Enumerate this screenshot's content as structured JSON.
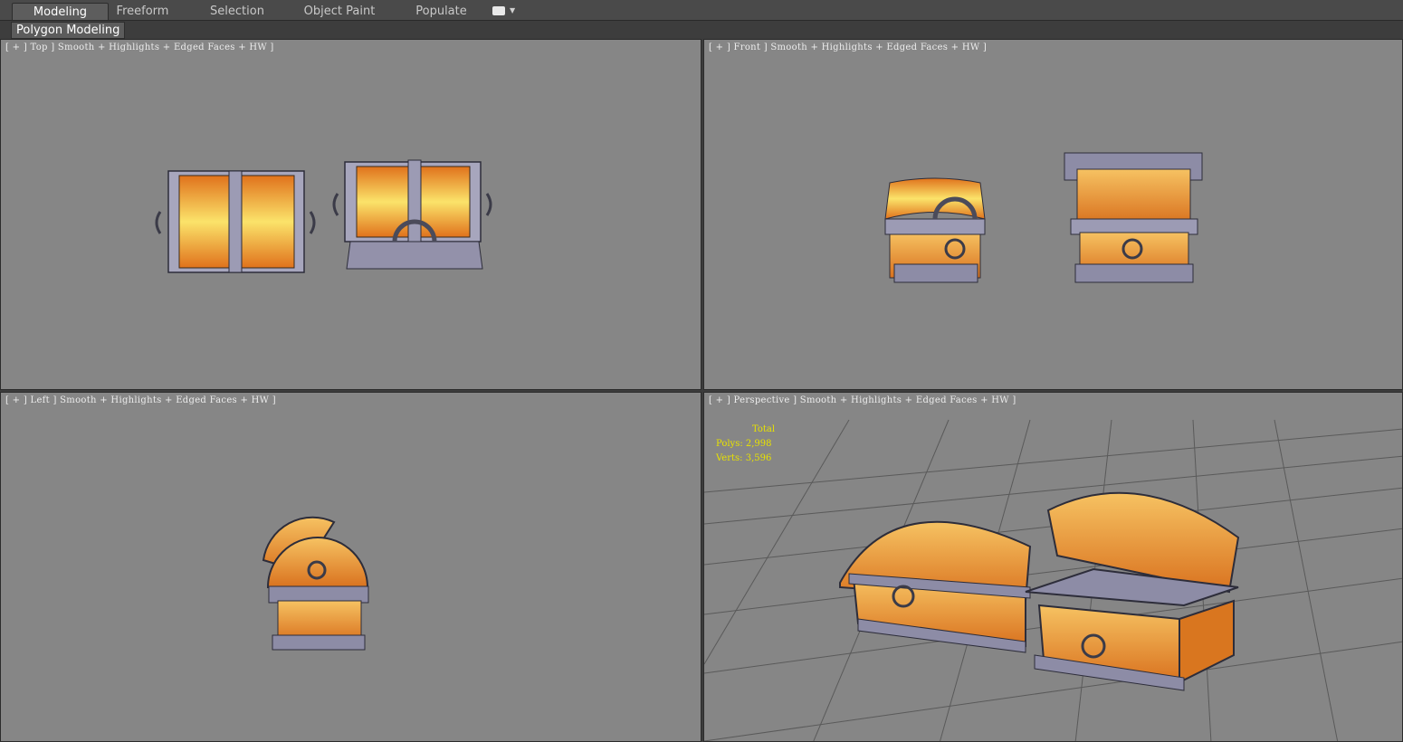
{
  "tabs": [
    {
      "label": "Modeling",
      "active": true
    },
    {
      "label": "Freeform",
      "active": false
    },
    {
      "label": "Selection",
      "active": false
    },
    {
      "label": "Object Paint",
      "active": false
    },
    {
      "label": "Populate",
      "active": false
    }
  ],
  "sub_panel": {
    "label": "Polygon Modeling"
  },
  "viewports": {
    "top": {
      "label": "[ + ] Top ] Smooth + Highlights + Edged Faces + HW ]"
    },
    "front": {
      "label": "[ + ] Front ] Smooth + Highlights + Edged Faces + HW ]"
    },
    "left": {
      "label": "[ + ] Left ] Smooth + Highlights + Edged Faces + HW ]"
    },
    "perspective": {
      "label": "[ + ] Perspective ] Smooth + Highlights + Edged Faces + HW ]"
    }
  },
  "stats": {
    "header": "Total",
    "polys": "Polys: 2,998",
    "verts": "Verts: 3,596"
  },
  "colors": {
    "viewport_bg": "#868686",
    "wood_light": "#f2b75a",
    "wood_dark": "#d9761f",
    "metal": "#8d8ca6",
    "stats_text": "#e8e200"
  }
}
